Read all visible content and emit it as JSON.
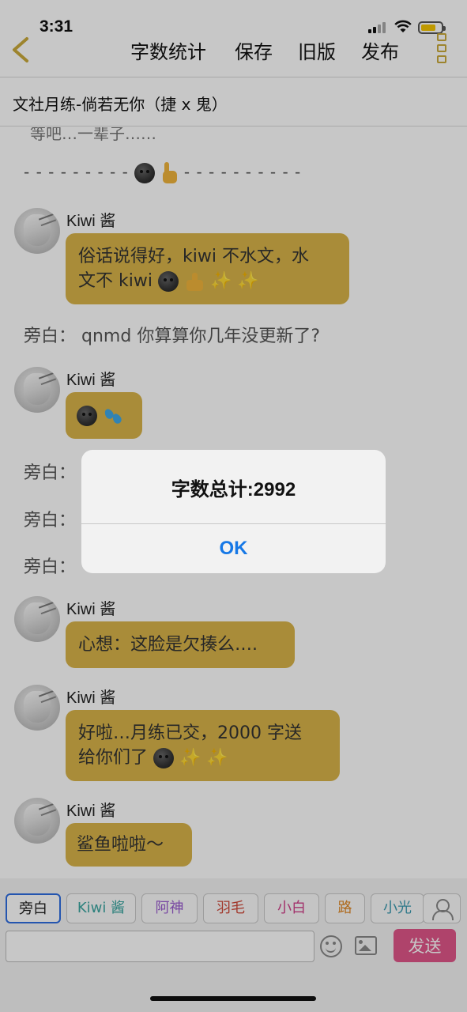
{
  "status_bar": {
    "time": "3:31"
  },
  "nav": {
    "word_count_label": "字数统计",
    "save_label": "保存",
    "old_version_label": "旧版",
    "publish_label": "发布"
  },
  "document": {
    "title": "文社月练-倘若无你（捷 x 鬼）"
  },
  "chat": {
    "cut_text": "等吧…一辈子……",
    "divider_left": "- - - - - - - - -",
    "divider_right": "- - - - - - - - - -",
    "messages": [
      {
        "sender": "Kiwi 酱",
        "line1": "俗话说得好，kiwi 不水文，水",
        "line2": "文不 kiwi"
      },
      {
        "narrator": "旁白：",
        "text": "qnmd 你算算你几年没更新了?"
      },
      {
        "sender": "Kiwi 酱"
      },
      {
        "narrator": "旁白："
      },
      {
        "narrator": "旁白："
      },
      {
        "narrator": "旁白："
      },
      {
        "sender": "Kiwi 酱",
        "text": "心想：这脸是欠揍么…."
      },
      {
        "sender": "Kiwi 酱",
        "line1": "好啦…月练已交，2000 字送",
        "line2": "给你们了"
      },
      {
        "sender": "Kiwi 酱",
        "text": "鲨鱼啦啦～"
      }
    ]
  },
  "roles": [
    {
      "label": "旁白",
      "color": "#222222"
    },
    {
      "label": "Kiwi 酱",
      "color": "#3aa6a0"
    },
    {
      "label": "阿神",
      "color": "#9a5bd0"
    },
    {
      "label": "羽毛",
      "color": "#d04a3a"
    },
    {
      "label": "小白",
      "color": "#d0408a"
    },
    {
      "label": "路",
      "color": "#e08a2a"
    },
    {
      "label": "小光",
      "color": "#3a9ab0"
    }
  ],
  "input": {
    "value": "",
    "placeholder": ""
  },
  "send_label": "发送",
  "alert": {
    "title": "字数总计:2992",
    "ok_label": "OK"
  },
  "colors": {
    "bubble": "#d9b44a",
    "send": "#e0568a",
    "accent": "#1678e6"
  }
}
